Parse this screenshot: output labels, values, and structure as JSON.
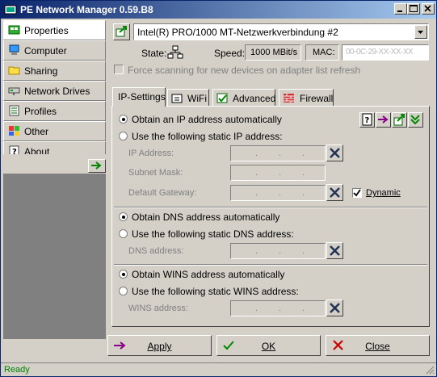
{
  "window": {
    "title": "PE Network Manager 0.59.B8"
  },
  "sidebar": {
    "items": [
      {
        "label": "Properties",
        "icon": "network-card-icon",
        "active": true
      },
      {
        "label": "Computer",
        "icon": "computer-icon"
      },
      {
        "label": "Sharing",
        "icon": "folder-share-icon"
      },
      {
        "label": "Network Drives",
        "icon": "network-drive-icon"
      },
      {
        "label": "Profiles",
        "icon": "profile-list-icon"
      },
      {
        "label": "Other",
        "icon": "windows-flag-icon"
      },
      {
        "label": "About",
        "icon": "help-question-icon"
      }
    ]
  },
  "adapter": {
    "selected": "Intel(R) PRO/1000 MT-Netzwerkverbindung #2",
    "state_label": "State:",
    "speed_label": "Speed:",
    "speed_value": "1000 MBit/s",
    "mac_label": "MAC:",
    "mac_value": "00-0C-29-XX-XX-XX",
    "force_scan_label": "Force scanning for new devices on adapter list refresh"
  },
  "tabs": [
    {
      "label": "IP-Settings",
      "active": true
    },
    {
      "label": "WiFi",
      "icon": "wifi-icon"
    },
    {
      "label": "Advanced",
      "icon": "advanced-icon"
    },
    {
      "label": "Firewall",
      "icon": "firewall-icon"
    }
  ],
  "ip": {
    "auto_label": "Obtain an IP address automatically",
    "static_label": "Use the following static IP address:",
    "ip_label": "IP Address:",
    "mask_label": "Subnet Mask:",
    "gateway_label": "Default Gateway:",
    "dynamic_label": "Dynamic",
    "dot": "."
  },
  "dns": {
    "auto_label": "Obtain DNS address automatically",
    "static_label": "Use the following static DNS address:",
    "dns_label": "DNS address:"
  },
  "wins": {
    "auto_label": "Obtain WINS address automatically",
    "static_label": "Use the following static WINS address:",
    "wins_label": "WINS address:"
  },
  "buttons": {
    "apply": "Apply",
    "ok": "OK",
    "close": "Close"
  },
  "status": {
    "text": "Ready"
  },
  "colors": {
    "title_start": "#0a246a",
    "title_end": "#a6caf0",
    "face": "#d4d0c8",
    "ready": "#008000"
  }
}
